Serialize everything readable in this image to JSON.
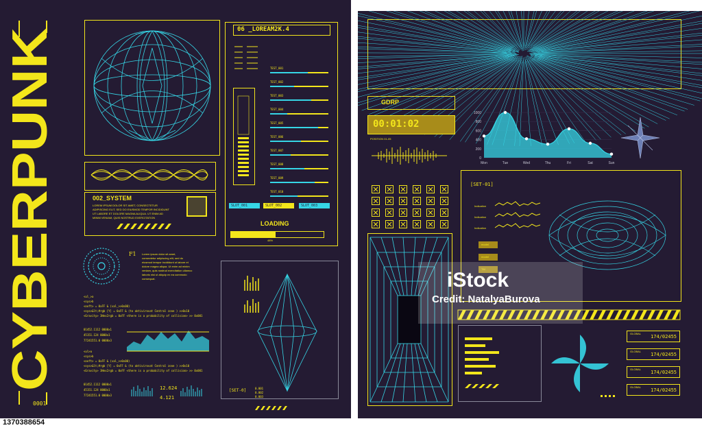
{
  "colors": {
    "background": "#241b33",
    "accent": "#f3e61b",
    "cyan": "#36d6e6"
  },
  "left": {
    "title": "CYBERPUNK",
    "footer_code": "0001",
    "panel_header": "06 _LOREAM2K.4",
    "system_title": "002_SYSTEM",
    "system_text": [
      "LOREM IPSUM DOLOR SIT AMET, CONSECTETUR",
      "ADIPISCING ELIT, SED DO EIUSMOD TEMPOR INCIDIDUNT",
      "UT LABORE ET DOLORE MAGNA ALIQUA. UT ENIM AD",
      "MINIM VENIAM, QUIS NOSTRUD EXERCITATION"
    ],
    "f1_label": "F1",
    "f1_text": [
      "Lorem ipsum dolor sit amet,",
      "consectetur adipiscing elit, sed do",
      "eiusmod tempor incididunt ut labore et",
      "dolore magna aliqua. Ut enim ad minim",
      "veniam, quis nostrud exercitation ullamco",
      "laboris nisi ut aliquip ex ea commodo",
      "consequat."
    ],
    "tests": [
      "TEST_001",
      "TEST_002",
      "TEST_003",
      "TEST_004",
      "TEST_005",
      "TEST_006",
      "TEST_007",
      "TEST_008",
      "TEST_009",
      "TEST_010"
    ],
    "slots": [
      "SLOT_001",
      "SLOT_002",
      "SLOT_003"
    ],
    "loading": "LOADING",
    "loading_percent": "48%",
    "progress": 0.48,
    "code_block_1": [
      "<ul_>a",
      "<sys>b",
      "<ooft> = 0xFF & (val_>>0x00)",
      "<sys>&lt;#rgb [Y] = 0xFF & (to aktivirovat Central zone ) >>0x10",
      "<Gravity> 3Hex2rgb = 0xFF <there is a probability of collision> >> 0x001"
    ],
    "numbers_1": [
      "01452.1112   0000x1",
      "45151.124    0000x1",
      "77241551.0  0000x3"
    ],
    "code_block_2": [
      "<ul>a",
      "<sys>b",
      "<ooft> = 0xFF & (val_>>0x00)",
      "<sys>&lt;#rgb [Y] = 0xFF & (to aktivirovat Central zone ) >>0x10",
      "<Gravity> 3Hex2rgb = 0xFF <there is a probability of collision> >> 0x001"
    ],
    "numbers_2": [
      "01452.1112   0000x1",
      "45151.124    0000x1",
      "77241551.0  0000x3"
    ],
    "stat_a": "12.624",
    "stat_b": "4.121",
    "set_label": "[SET-0]",
    "id_rows": [
      "0.001",
      "0.002",
      "0.003"
    ]
  },
  "right": {
    "gdrp": "GDRP",
    "timer": "00:01:02",
    "position": "POSITION 01-05",
    "set_label": "[SET-01]",
    "indications": [
      "Indication",
      "Indication",
      "Indication"
    ],
    "models": [
      "model",
      "model",
      "TM"
    ],
    "badge_label": "GLOBAL",
    "badges": [
      "174/02455",
      "174/02455",
      "174/02455",
      "174/02455"
    ]
  },
  "chart_data": {
    "type": "area",
    "categories": [
      "Mon",
      "Tue",
      "Wed",
      "Thu",
      "Fri",
      "Sat",
      "Sun"
    ],
    "values": [
      480,
      1000,
      420,
      300,
      640,
      320,
      80
    ],
    "yticks": [
      0,
      200,
      400,
      600,
      800,
      1000
    ],
    "ylim": [
      0,
      1000
    ],
    "title": "",
    "xlabel": "",
    "ylabel": ""
  },
  "watermark": {
    "brand": "iStock",
    "credit": "Credit: NatalyaBurova"
  },
  "stock_id": "1370388654"
}
